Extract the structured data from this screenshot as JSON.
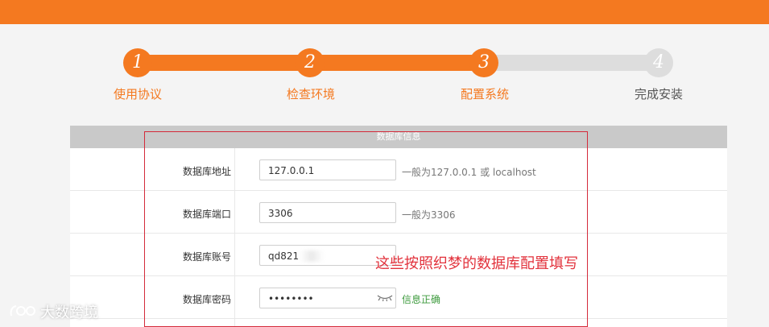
{
  "header": {
    "title": ""
  },
  "steps": [
    {
      "number": "1",
      "label": "使用协议",
      "status": "done"
    },
    {
      "number": "2",
      "label": "检查环境",
      "status": "done"
    },
    {
      "number": "3",
      "label": "配置系统",
      "status": "done"
    },
    {
      "number": "4",
      "label": "完成安装",
      "status": "todo"
    }
  ],
  "section": {
    "title": "数据库信息"
  },
  "form": {
    "host": {
      "label": "数据库地址",
      "value": "127.0.0.1",
      "hint": "一般为127.0.0.1 或 localhost"
    },
    "port": {
      "label": "数据库端口",
      "value": "3306",
      "hint": "一般为3306"
    },
    "user": {
      "label": "数据库账号",
      "value": "qd821"
    },
    "password": {
      "label": "数据库密码",
      "value": "••••••••",
      "hint": "信息正确"
    }
  },
  "annotation": "这些按照织梦的数据库配置填写",
  "watermark": "大数跨境",
  "colors": {
    "accent": "#f47920",
    "ok": "#3c9a3c",
    "annotation": "#e2323c",
    "inactive": "#dddddd"
  }
}
